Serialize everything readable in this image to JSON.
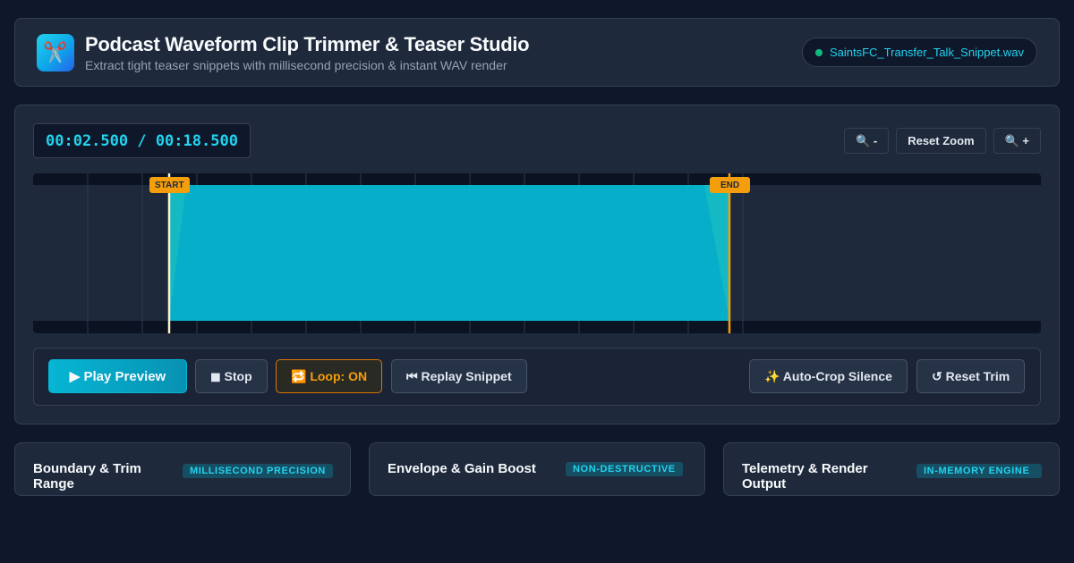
{
  "header": {
    "app_icon": "scissors-icon",
    "app_icon_glyph": "✂️",
    "title": "Podcast Waveform Clip Trimmer & Teaser Studio",
    "subtitle": "Extract tight teaser snippets with millisecond precision & instant WAV render",
    "file_name": "SaintsFC_Transfer_Talk_Snippet.wav",
    "file_status_color": "#10b981"
  },
  "editor": {
    "time_readout": "00:02.500 / 00:18.500",
    "zoom_out_label": "🔍 -",
    "reset_zoom_label": "Reset Zoom",
    "zoom_in_label": "🔍 +",
    "waveform": {
      "start_label": "START",
      "end_label": "END",
      "playhead_color": "#fef3c7",
      "selection_color": "#06b6d4",
      "marker_color": "#f59e0b"
    }
  },
  "transport": {
    "play_label": "▶  Play Preview",
    "stop_label": "◼ Stop",
    "loop_label": "🔁 Loop: ON",
    "replay_label": "⏮ Replay Snippet",
    "autocrop_label": "✨ Auto-Crop Silence",
    "reset_trim_label": "↺ Reset Trim"
  },
  "cards": [
    {
      "title": "Boundary & Trim Range",
      "badge": "MILLISECOND PRECISION"
    },
    {
      "title": "Envelope & Gain Boost",
      "badge": "NON-DESTRUCTIVE"
    },
    {
      "title": "Telemetry & Render Output",
      "badge": "IN-MEMORY ENGINE"
    }
  ],
  "colors": {
    "accent": "#22d3ee",
    "warning": "#f59e0b",
    "background": "#0f172a",
    "panel": "#1e293b"
  }
}
